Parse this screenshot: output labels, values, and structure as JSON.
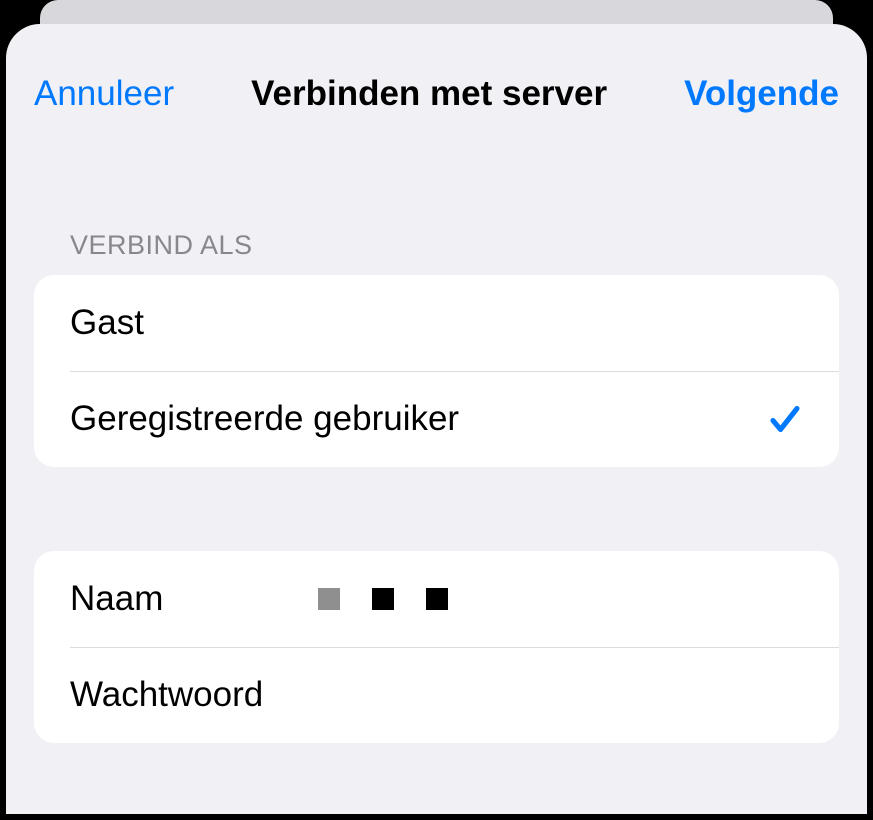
{
  "nav": {
    "cancel": "Annuleer",
    "title": "Verbinden met server",
    "next": "Volgende"
  },
  "connect_as": {
    "header": "Verbind als",
    "options": [
      {
        "label": "Gast",
        "selected": false
      },
      {
        "label": "Geregistreerde gebruiker",
        "selected": true
      }
    ]
  },
  "credentials": {
    "name_label": "Naam",
    "password_label": "Wachtwoord"
  }
}
